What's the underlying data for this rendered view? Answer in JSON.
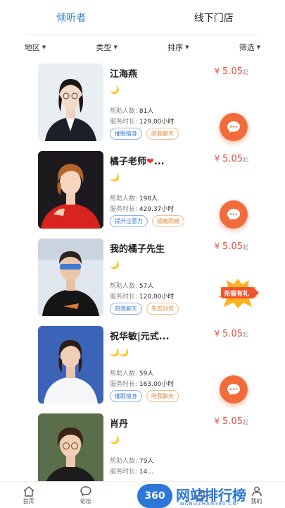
{
  "tabs": {
    "listeners": "倾听者",
    "offline": "线下门店"
  },
  "filters": [
    {
      "label": "地区"
    },
    {
      "label": "类型"
    },
    {
      "label": "排序"
    },
    {
      "label": "筛选"
    }
  ],
  "labels": {
    "helped": "帮助人数:",
    "duration": "服务时长:",
    "currency": "¥",
    "qi": "起"
  },
  "counselors": [
    {
      "name": "江海燕",
      "heart": "",
      "moons": "🌙",
      "helped": "81人",
      "duration": "129.00小时",
      "price": "5.05",
      "tags": [
        {
          "text": "催眠瘦身",
          "style": "blue"
        },
        {
          "text": "陪我聊天",
          "style": "orange"
        }
      ]
    },
    {
      "name": "橘子老师",
      "heart": "❤",
      "name_suffix": "...",
      "moons": "🌙",
      "helped": "198人",
      "duration": "429.37小时",
      "price": "5.05",
      "tags": [
        {
          "text": "提升注意力",
          "style": "blue"
        },
        {
          "text": "成瘾网瘾",
          "style": "orange"
        }
      ]
    },
    {
      "name": "我的橘子先生",
      "heart": "",
      "moons": "🌙",
      "helped": "57人",
      "duration": "120.00小时",
      "price": "5.05",
      "tags": [
        {
          "text": "陪我聊天",
          "style": "blue"
        },
        {
          "text": "失恋别伤",
          "style": "orange"
        }
      ]
    },
    {
      "name": "祝华敏|元式...",
      "heart": "",
      "moons": "🌙🌙",
      "helped": "59人",
      "duration": "163.00小时",
      "price": "5.05",
      "tags": [
        {
          "text": "催眠瘦身",
          "style": "blue"
        },
        {
          "text": "陪我聊天",
          "style": "orange"
        }
      ]
    },
    {
      "name": "肖丹",
      "heart": "",
      "moons": "🌙",
      "helped": "79人",
      "duration": "14...",
      "price": "5.05",
      "tags": []
    }
  ],
  "promo": {
    "text": "充值有礼"
  },
  "nav": [
    {
      "label": "首页",
      "icon": "home-icon"
    },
    {
      "label": "论坛",
      "icon": "forum-icon"
    },
    {
      "label": "",
      "icon": "center-icon"
    },
    {
      "label": "",
      "icon": "news-icon"
    },
    {
      "label": "我的",
      "icon": "profile-icon"
    }
  ],
  "watermark": {
    "badge": "360",
    "title": "网站排行榜",
    "sub": "WANGZHAN360.CN-"
  },
  "colors": {
    "accent": "#3a7bd5",
    "price": "#e64a3c",
    "chat": "#f26b3a",
    "watermark": "#2c77d8"
  }
}
